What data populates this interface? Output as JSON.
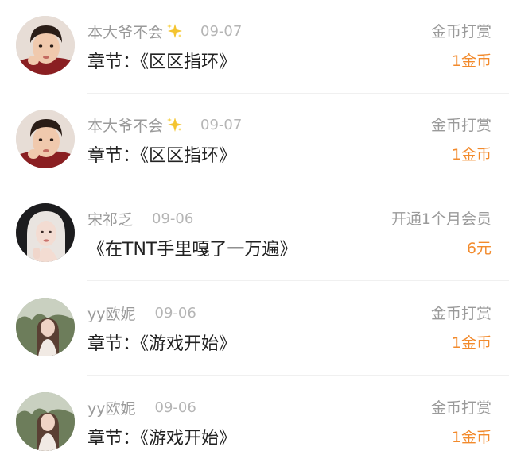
{
  "records": [
    {
      "avatar": "boy-avatar",
      "username": "本大爷不会",
      "badge": "sparkles-icon",
      "date": "09-07",
      "content": "章节：《区区指环》",
      "type": "金币打赏",
      "amount": "1金币"
    },
    {
      "avatar": "boy-avatar",
      "username": "本大爷不会",
      "badge": "sparkles-icon",
      "date": "09-07",
      "content": "章节：《区区指环》",
      "type": "金币打赏",
      "amount": "1金币"
    },
    {
      "avatar": "blonde-girl-avatar",
      "username": "宋祁乏",
      "date": "09-06",
      "content": "《在TNT手里嘎了一万遍》",
      "type": "开通1个月会员",
      "amount": "6元"
    },
    {
      "avatar": "outdoor-girl-avatar",
      "username": "yy欧妮",
      "date": "09-06",
      "content": "章节：《游戏开始》",
      "type": "金币打赏",
      "amount": "1金币"
    },
    {
      "avatar": "outdoor-girl-avatar",
      "username": "yy欧妮",
      "date": "09-06",
      "content": "章节：《游戏开始》",
      "type": "金币打赏",
      "amount": "1金币"
    }
  ],
  "colors": {
    "username": "#9a9a9a",
    "date": "#b5b5b5",
    "content": "#222222",
    "amount": "#f28a2c"
  }
}
